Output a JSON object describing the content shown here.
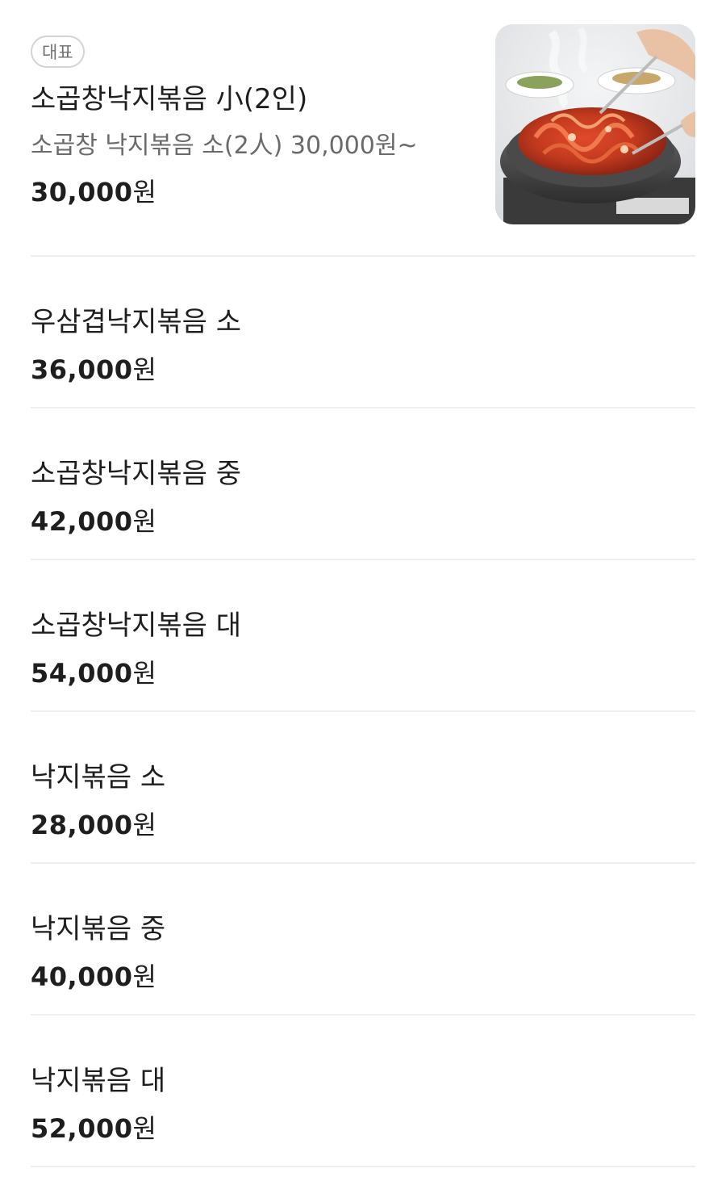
{
  "menu": {
    "featured": {
      "badge": "대표",
      "name": "소곱창낙지볶음 小(2인)",
      "description": "소곱창 낙지볶음 소(2人) 30,000원~",
      "price_number": "30,000",
      "price_unit": "원",
      "thumbnail_icon": "food-photo"
    },
    "items": [
      {
        "name": "우삼겹낙지볶음 소",
        "price_number": "36,000",
        "price_unit": "원"
      },
      {
        "name": "소곱창낙지볶음 중",
        "price_number": "42,000",
        "price_unit": "원"
      },
      {
        "name": "소곱창낙지볶음 대",
        "price_number": "54,000",
        "price_unit": "원"
      },
      {
        "name": "낙지볶음 소",
        "price_number": "28,000",
        "price_unit": "원"
      },
      {
        "name": "낙지볶음 중",
        "price_number": "40,000",
        "price_unit": "원"
      },
      {
        "name": "낙지볶음 대",
        "price_number": "52,000",
        "price_unit": "원"
      }
    ]
  },
  "colors": {
    "text_primary": "#1e1e1e",
    "text_secondary": "#6a6a6a",
    "divider": "#eeeeee",
    "badge_border": "#d4d4d4"
  }
}
